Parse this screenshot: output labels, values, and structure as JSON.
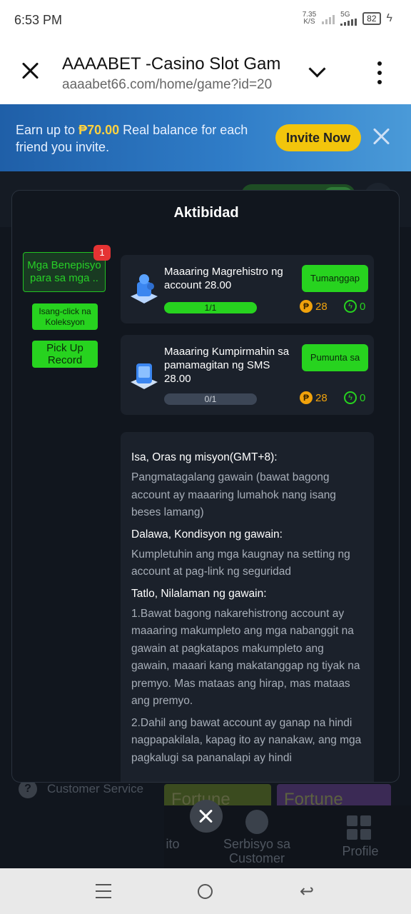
{
  "status": {
    "time": "6:53 PM",
    "net_speed_value": "7.35",
    "net_speed_unit": "K/S",
    "network": "5G",
    "battery": "82"
  },
  "browser": {
    "title": "AAAABET -Casino Slot Gam",
    "url": "aaaabet66.com/home/game?id=20"
  },
  "banner": {
    "text_prefix": "Earn up to ",
    "amount": "₱70.00",
    "text_suffix": " Real balance for each friend you invite.",
    "invite_label": "Invite Now"
  },
  "background": {
    "customer_service": "Customer Service",
    "tile_a": "Fortune",
    "tile_b": "Fortune",
    "nav_left": "ito",
    "nav_service": "Serbisyo sa Customer",
    "nav_profile": "Profile"
  },
  "modal": {
    "title": "Aktibidad",
    "tabs": [
      {
        "label": "Mga Benepisyo para sa mga ..",
        "badge": "1"
      },
      {
        "label": "Isang-click na Koleksyon"
      },
      {
        "label": "Pick Up Record"
      }
    ],
    "tasks": [
      {
        "name": "Maaaring Magrehistro ng account 28.00",
        "button": "Tumanggap",
        "progress_text": "1/1",
        "progress": 1.0,
        "coins": "28",
        "energy": "0",
        "icon": "user-register-icon"
      },
      {
        "name": "Maaaring Kumpirmahin sa pamamagitan ng SMS 28.00",
        "button": "Pumunta sa",
        "progress_text": "0/1",
        "progress": 0.0,
        "coins": "28",
        "energy": "0",
        "icon": "phone-sms-icon"
      }
    ],
    "rules": [
      {
        "heading": "Isa, Oras ng misyon(GMT+8):",
        "body": "Pangmatagalang gawain (bawat bagong account ay maaaring lumahok nang isang beses lamang)"
      },
      {
        "heading": "Dalawa, Kondisyon ng gawain:",
        "body": "Kumpletuhin ang mga kaugnay na setting ng account at pag-link ng seguridad"
      },
      {
        "heading": "Tatlo, Nilalaman ng gawain:",
        "body": "1.Bawat bagong nakarehistrong account ay maaaring makumpleto ang mga nabanggit na gawain at pagkatapos makumpleto ang gawain, maaari kang makatanggap ng tiyak na premyo. Mas mataas ang hirap, mas mataas ang premyo.",
        "body2": "2.Dahil ang bawat account ay ganap na hindi nagpapakilala, kapag ito ay nanakaw, ang mga pagkalugi sa pananalapi ay hindi"
      }
    ]
  },
  "colors": {
    "accent_green": "#27d31f",
    "coin_gold": "#f0a20c",
    "banner_blue": "#2f7cc7",
    "invite_yellow": "#f2c50c"
  }
}
